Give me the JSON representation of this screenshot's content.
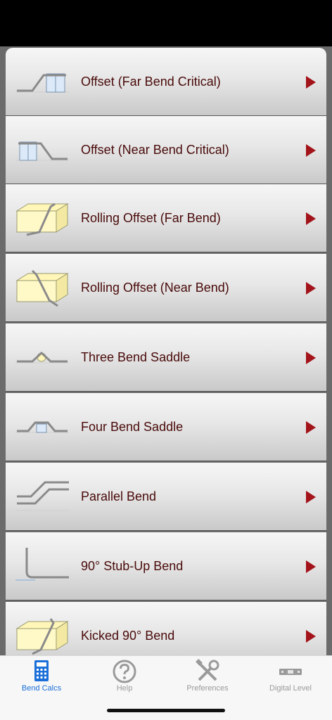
{
  "colors": {
    "label_text": "#4a0a0a",
    "chevron": "#a3141a",
    "tab_active": "#1a6fd8",
    "tab_inactive": "#9a9a9a"
  },
  "list": {
    "items": [
      {
        "label": "Offset (Far Bend Critical)",
        "icon": "offset-far-bend-icon"
      },
      {
        "label": "Offset (Near Bend Critical)",
        "icon": "offset-near-bend-icon"
      },
      {
        "label": "Rolling Offset (Far Bend)",
        "icon": "rolling-offset-far-icon"
      },
      {
        "label": "Rolling Offset (Near Bend)",
        "icon": "rolling-offset-near-icon"
      },
      {
        "label": "Three Bend Saddle",
        "icon": "three-bend-saddle-icon"
      },
      {
        "label": "Four Bend Saddle",
        "icon": "four-bend-saddle-icon"
      },
      {
        "label": "Parallel Bend",
        "icon": "parallel-bend-icon"
      },
      {
        "label": "90° Stub-Up Bend",
        "icon": "stub-up-bend-icon"
      },
      {
        "label": "Kicked 90° Bend",
        "icon": "kicked-90-bend-icon"
      }
    ]
  },
  "tabs": [
    {
      "label": "Bend Calcs",
      "icon": "calculator-icon",
      "active": true
    },
    {
      "label": "Help",
      "icon": "help-icon",
      "active": false
    },
    {
      "label": "Preferences",
      "icon": "tools-icon",
      "active": false
    },
    {
      "label": "Digital Level",
      "icon": "level-icon",
      "active": false
    }
  ]
}
